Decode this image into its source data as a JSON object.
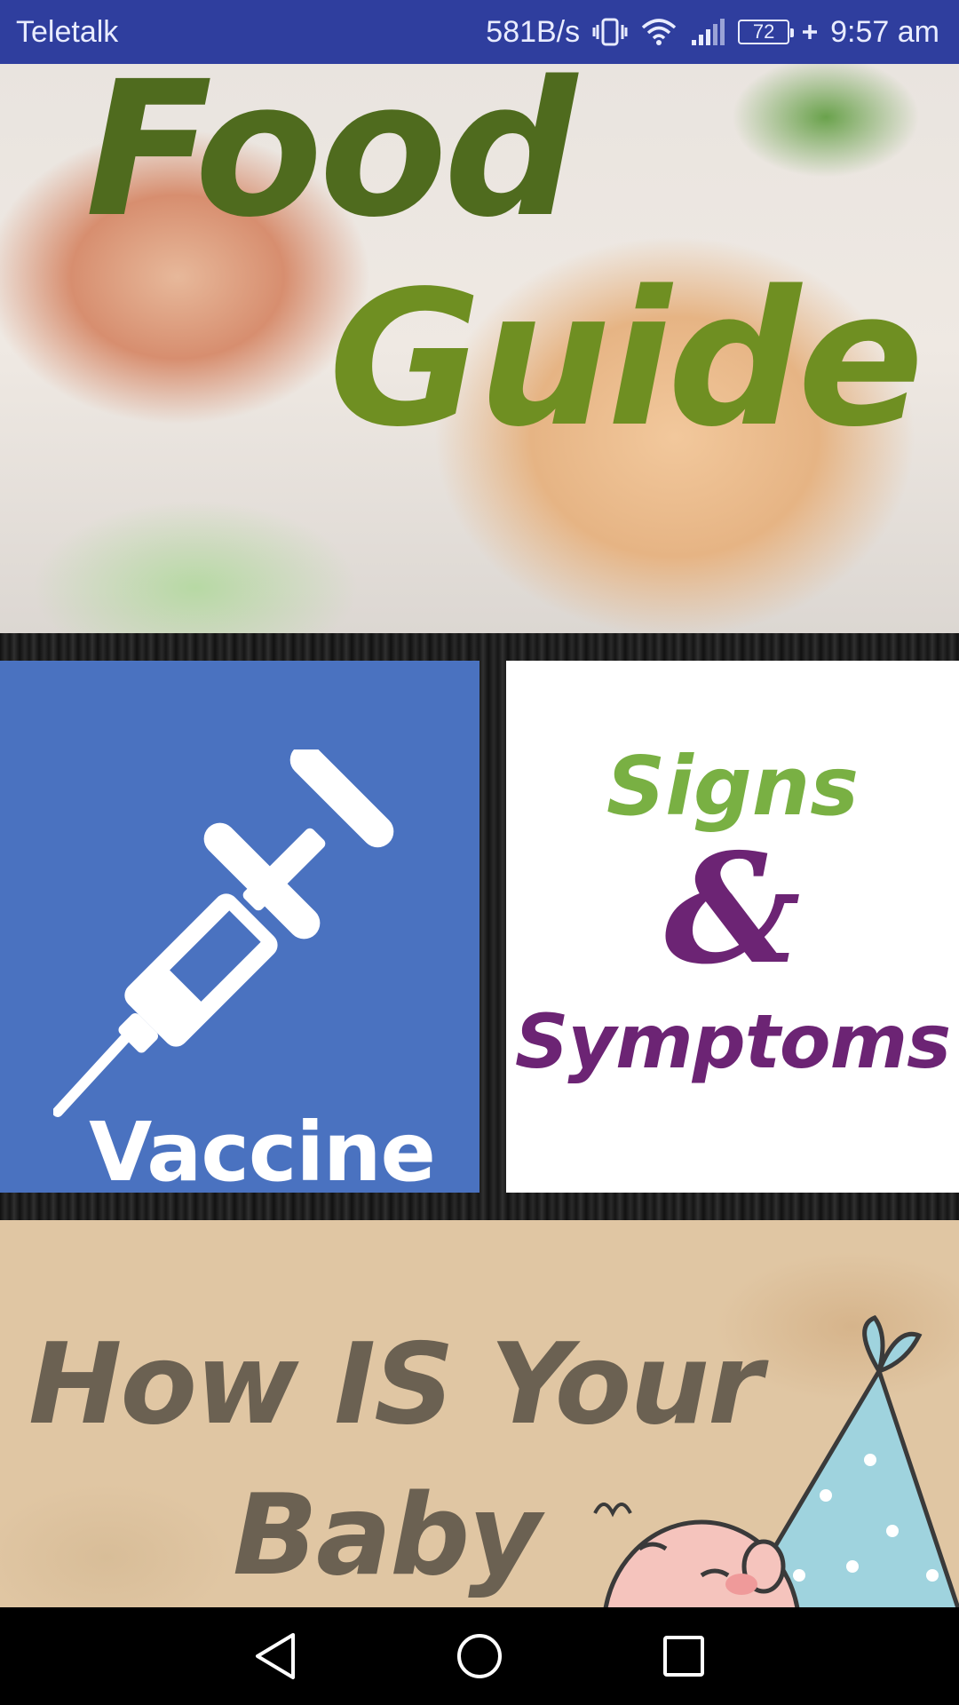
{
  "status_bar": {
    "carrier": "Teletalk",
    "speed": "581B/s",
    "battery": "72",
    "time": "9:57 am",
    "icons": [
      "vibrate-icon",
      "wifi-icon",
      "signal-icon",
      "battery-icon",
      "charging-icon"
    ]
  },
  "tiles": {
    "food_guide": {
      "line1": "Food",
      "line2": "Guide"
    },
    "vaccine": {
      "label": "Vaccine",
      "icon": "syringe-icon"
    },
    "signs": {
      "word1": "Signs",
      "amp": "&",
      "word2": "Symptoms"
    },
    "baby": {
      "line1": "How IS Your",
      "line2": "Baby"
    }
  },
  "nav": {
    "icons": [
      "back-icon",
      "home-icon",
      "recents-icon"
    ]
  },
  "colors": {
    "status_bar": "#2f3e9e",
    "vaccine_tile": "#4a72c0",
    "signs_green": "#79b043",
    "symptoms_purple": "#6c2474",
    "baby_bg": "#e0c6a3"
  }
}
